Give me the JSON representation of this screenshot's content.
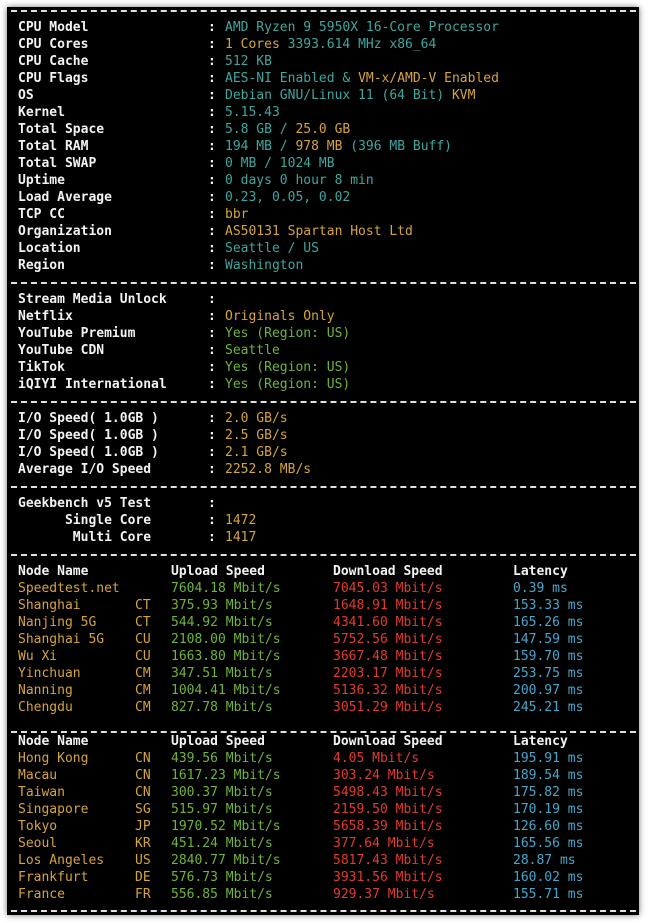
{
  "sysinfo": [
    {
      "key": "CPU Model",
      "parts": [
        {
          "t": "AMD Ryzen 9 5950X 16-Core Processor",
          "c": "c"
        }
      ]
    },
    {
      "key": "CPU Cores",
      "parts": [
        {
          "t": "1 Cores ",
          "c": "y"
        },
        {
          "t": "3393.614 MHz x86_64",
          "c": "c"
        }
      ]
    },
    {
      "key": "CPU Cache",
      "parts": [
        {
          "t": "512 KB",
          "c": "c"
        }
      ]
    },
    {
      "key": "CPU Flags",
      "parts": [
        {
          "t": "AES-NI Enabled & ",
          "c": "c"
        },
        {
          "t": "VM-x/AMD-V Enabled",
          "c": "y"
        }
      ]
    },
    {
      "key": "OS",
      "parts": [
        {
          "t": "Debian GNU/Linux 11 (64 Bit) ",
          "c": "c"
        },
        {
          "t": "KVM",
          "c": "y"
        }
      ]
    },
    {
      "key": "Kernel",
      "parts": [
        {
          "t": "5.15.43",
          "c": "c"
        }
      ]
    },
    {
      "key": "Total Space",
      "parts": [
        {
          "t": "5.8 GB / ",
          "c": "c"
        },
        {
          "t": "25.0 GB",
          "c": "y"
        }
      ]
    },
    {
      "key": "Total RAM",
      "parts": [
        {
          "t": "194 MB / ",
          "c": "c"
        },
        {
          "t": "978 MB",
          "c": "y"
        },
        {
          "t": " (396 MB Buff)",
          "c": "c"
        }
      ]
    },
    {
      "key": "Total SWAP",
      "parts": [
        {
          "t": "0 MB / 1024 MB",
          "c": "c"
        }
      ]
    },
    {
      "key": "Uptime",
      "parts": [
        {
          "t": "0 days 0 hour 8 min",
          "c": "c"
        }
      ]
    },
    {
      "key": "Load Average",
      "parts": [
        {
          "t": "0.23, 0.05, 0.02",
          "c": "c"
        }
      ]
    },
    {
      "key": "TCP CC",
      "parts": [
        {
          "t": "bbr",
          "c": "y"
        }
      ]
    },
    {
      "key": "Organization",
      "parts": [
        {
          "t": "AS50131 Spartan Host Ltd",
          "c": "y"
        }
      ]
    },
    {
      "key": "Location",
      "parts": [
        {
          "t": "Seattle / US",
          "c": "c"
        }
      ]
    },
    {
      "key": "Region",
      "parts": [
        {
          "t": "Washington",
          "c": "c"
        }
      ]
    }
  ],
  "stream": {
    "title": "Stream Media Unlock",
    "items": [
      {
        "key": "Netflix",
        "value": "Originals Only",
        "c": "y"
      },
      {
        "key": "YouTube Premium",
        "value": "Yes (Region: US)",
        "c": "g"
      },
      {
        "key": "YouTube CDN",
        "value": "Seattle",
        "c": "g"
      },
      {
        "key": "TikTok",
        "value": "Yes (Region: US)",
        "c": "g"
      },
      {
        "key": "iQIYI International",
        "value": "Yes (Region: US)",
        "c": "g"
      }
    ]
  },
  "io": [
    {
      "key": "I/O Speed( 1.0GB )",
      "value": "2.0 GB/s",
      "c": "y"
    },
    {
      "key": "I/O Speed( 1.0GB )",
      "value": "2.5 GB/s",
      "c": "y"
    },
    {
      "key": "I/O Speed( 1.0GB )",
      "value": "2.1 GB/s",
      "c": "y"
    },
    {
      "key": "Average I/O Speed",
      "value": "2252.8 MB/s",
      "c": "y"
    }
  ],
  "geekbench": {
    "title": "Geekbench v5 Test",
    "items": [
      {
        "key": "      Single Core",
        "value": "1472",
        "c": "y"
      },
      {
        "key": "       Multi Core",
        "value": "1417",
        "c": "y"
      }
    ]
  },
  "speed_headers": {
    "node": "Node Name",
    "upload": "Upload Speed",
    "download": "Download Speed",
    "latency": "Latency"
  },
  "speed_table_1": [
    {
      "node": "Speedtest.net",
      "code": "",
      "upload": "7604.18 Mbit/s",
      "download": "7045.03 Mbit/s",
      "latency": "0.39 ms"
    },
    {
      "node": "Shanghai",
      "code": "CT",
      "upload": "375.93 Mbit/s",
      "download": "1648.91 Mbit/s",
      "latency": "153.33 ms"
    },
    {
      "node": "Nanjing 5G",
      "code": "CT",
      "upload": "544.92 Mbit/s",
      "download": "4341.60 Mbit/s",
      "latency": "165.26 ms"
    },
    {
      "node": "Shanghai 5G",
      "code": "CU",
      "upload": "2108.00 Mbit/s",
      "download": "5752.56 Mbit/s",
      "latency": "147.59 ms"
    },
    {
      "node": "Wu Xi",
      "code": "CU",
      "upload": "1663.80 Mbit/s",
      "download": "3667.48 Mbit/s",
      "latency": "159.70 ms"
    },
    {
      "node": "Yinchuan",
      "code": "CM",
      "upload": "347.51 Mbit/s",
      "download": "2203.17 Mbit/s",
      "latency": "253.75 ms"
    },
    {
      "node": "Nanning",
      "code": "CM",
      "upload": "1004.41 Mbit/s",
      "download": "5136.32 Mbit/s",
      "latency": "200.97 ms"
    },
    {
      "node": "Chengdu",
      "code": "CM",
      "upload": "827.78 Mbit/s",
      "download": "3051.29 Mbit/s",
      "latency": "245.21 ms"
    }
  ],
  "speed_table_2": [
    {
      "node": "Hong Kong",
      "code": "CN",
      "upload": "439.56 Mbit/s",
      "download": "4.05 Mbit/s",
      "latency": "195.91 ms"
    },
    {
      "node": "Macau",
      "code": "CN",
      "upload": "1617.23 Mbit/s",
      "download": "303.24 Mbit/s",
      "latency": "189.54 ms"
    },
    {
      "node": "Taiwan",
      "code": "CN",
      "upload": "300.37 Mbit/s",
      "download": "5498.43 Mbit/s",
      "latency": "175.82 ms"
    },
    {
      "node": "Singapore",
      "code": "SG",
      "upload": "515.97 Mbit/s",
      "download": "2159.50 Mbit/s",
      "latency": "170.19 ms"
    },
    {
      "node": "Tokyo",
      "code": "JP",
      "upload": "1970.52 Mbit/s",
      "download": "5658.39 Mbit/s",
      "latency": "126.60 ms"
    },
    {
      "node": "Seoul",
      "code": "KR",
      "upload": "451.24 Mbit/s",
      "download": "377.64 Mbit/s",
      "latency": "165.56 ms"
    },
    {
      "node": "Los Angeles",
      "code": "US",
      "upload": "2840.77 Mbit/s",
      "download": "5817.43 Mbit/s",
      "latency": "28.87 ms"
    },
    {
      "node": "Frankfurt",
      "code": "DE",
      "upload": "576.73 Mbit/s",
      "download": "3931.56 Mbit/s",
      "latency": "160.02 ms"
    },
    {
      "node": "France",
      "code": "FR",
      "upload": "556.85 Mbit/s",
      "download": "929.37 Mbit/s",
      "latency": "155.71 ms"
    }
  ]
}
